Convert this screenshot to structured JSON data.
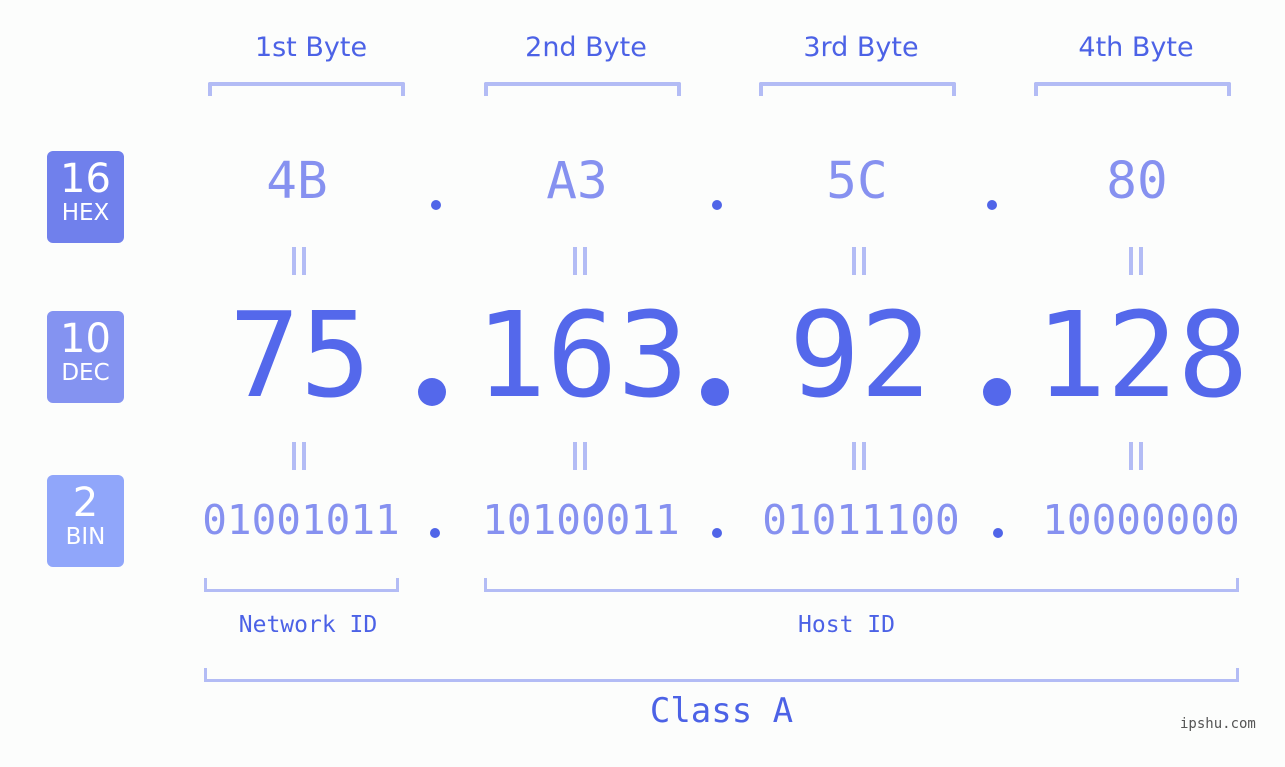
{
  "bytes": [
    {
      "title": "1st Byte",
      "hex": "4B",
      "dec": "75",
      "bin": "01001011"
    },
    {
      "title": "2nd Byte",
      "hex": "A3",
      "dec": "163",
      "bin": "10100011"
    },
    {
      "title": "3rd Byte",
      "hex": "5C",
      "dec": "92",
      "bin": "01011100"
    },
    {
      "title": "4th Byte",
      "hex": "80",
      "dec": "128",
      "bin": "10000000"
    }
  ],
  "badges": {
    "hex": {
      "num": "16",
      "label": "HEX",
      "color": "#7080ec"
    },
    "dec": {
      "num": "10",
      "label": "DEC",
      "color": "#8493f1"
    },
    "bin": {
      "num": "2",
      "label": "BIN",
      "color": "#90a6fa"
    }
  },
  "segments": {
    "network": "Network ID",
    "host": "Host ID"
  },
  "ip_class": "Class A",
  "watermark": "ipshu.com",
  "colors": {
    "accent": "#4c62e6",
    "light_text": "#8691f0",
    "bracket": "#b3bcf5"
  }
}
